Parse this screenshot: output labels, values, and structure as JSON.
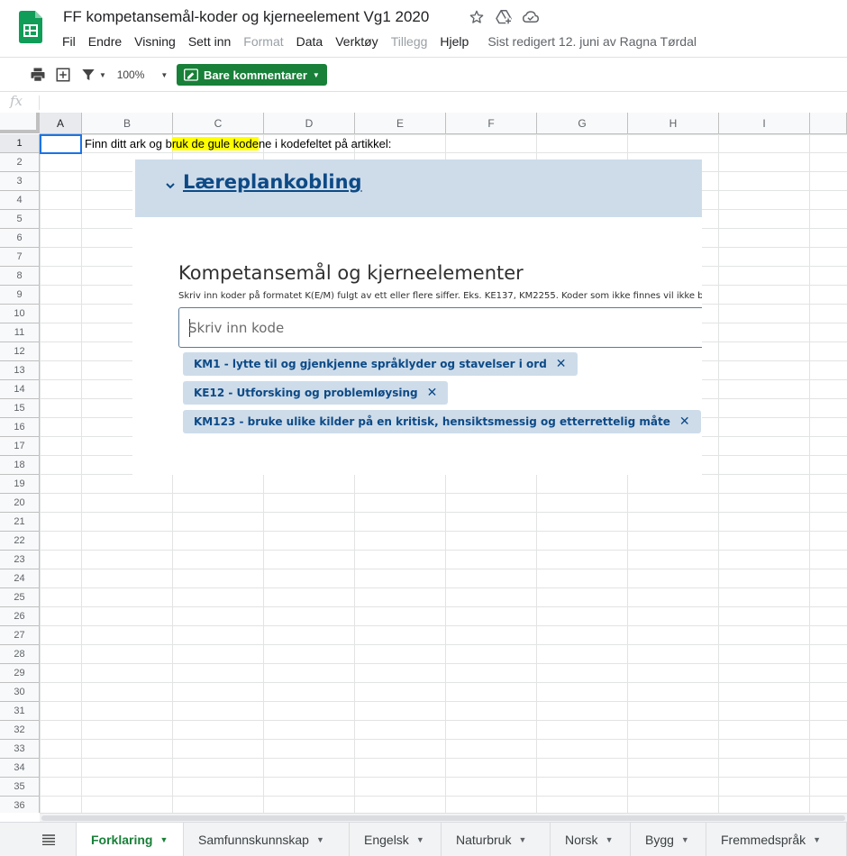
{
  "document": {
    "title": "FF kompetansemål-koder og kjerneelement Vg1 2020",
    "last_edit": "Sist redigert 12. juni av Ragna Tørdal"
  },
  "menu": [
    "Fil",
    "Endre",
    "Visning",
    "Sett inn",
    "Format",
    "Data",
    "Verktøy",
    "Tillegg",
    "Hjelp"
  ],
  "menu_disabled": [
    "Format",
    "Tillegg"
  ],
  "toolbar": {
    "zoom": "100%",
    "mode_label": "Bare kommentarer"
  },
  "formula_bar": {
    "fx_label": "fx",
    "value": ""
  },
  "grid": {
    "columns": [
      "A",
      "B",
      "C",
      "D",
      "E",
      "F",
      "G",
      "H",
      "I"
    ],
    "rows": [
      "1",
      "2",
      "3",
      "4",
      "5",
      "6",
      "7",
      "8",
      "9",
      "10",
      "11",
      "12",
      "13",
      "14",
      "15",
      "16",
      "17",
      "18",
      "19",
      "20",
      "21",
      "22",
      "23",
      "24",
      "25",
      "26",
      "27",
      "28",
      "29",
      "30",
      "31",
      "32",
      "33",
      "34",
      "35",
      "36"
    ],
    "selected_cell": "A1",
    "b1_before": "Finn ditt ark og b",
    "b1_highlight": "ruk de gule kode",
    "b1_after": "ne i kodefeltet på artikkel:"
  },
  "embed": {
    "section_title": "Læreplankobling",
    "heading": "Kompetansemål og kjerneelementer",
    "help": "Skriv inn koder på formatet K(E/M) fulgt av ett eller flere siffer. Eks. KE137, KM2255. Koder som ikke finnes vil ikke bli op",
    "input_placeholder": "Skriv inn kode",
    "tags": [
      "KM1 - lytte til og gjenkjenne språklyder og stavelser i ord",
      "KE12 - Utforsking og problemløysing",
      "KM123 - bruke ulike kilder på en kritisk, hensiktsmessig og etterrettelig måte"
    ]
  },
  "sheets": {
    "active": "Forklaring",
    "tabs": [
      "Forklaring",
      "Samfunnskunnskap",
      "Engelsk",
      "Naturbruk",
      "Norsk",
      "Bygg",
      "Fremmedspråk"
    ]
  },
  "colors": {
    "accent_green": "#188038",
    "highlight_yellow": "#ffff00",
    "embed_header": "#cedcea",
    "embed_link": "#0d4a86",
    "selection_blue": "#1a73e8"
  }
}
